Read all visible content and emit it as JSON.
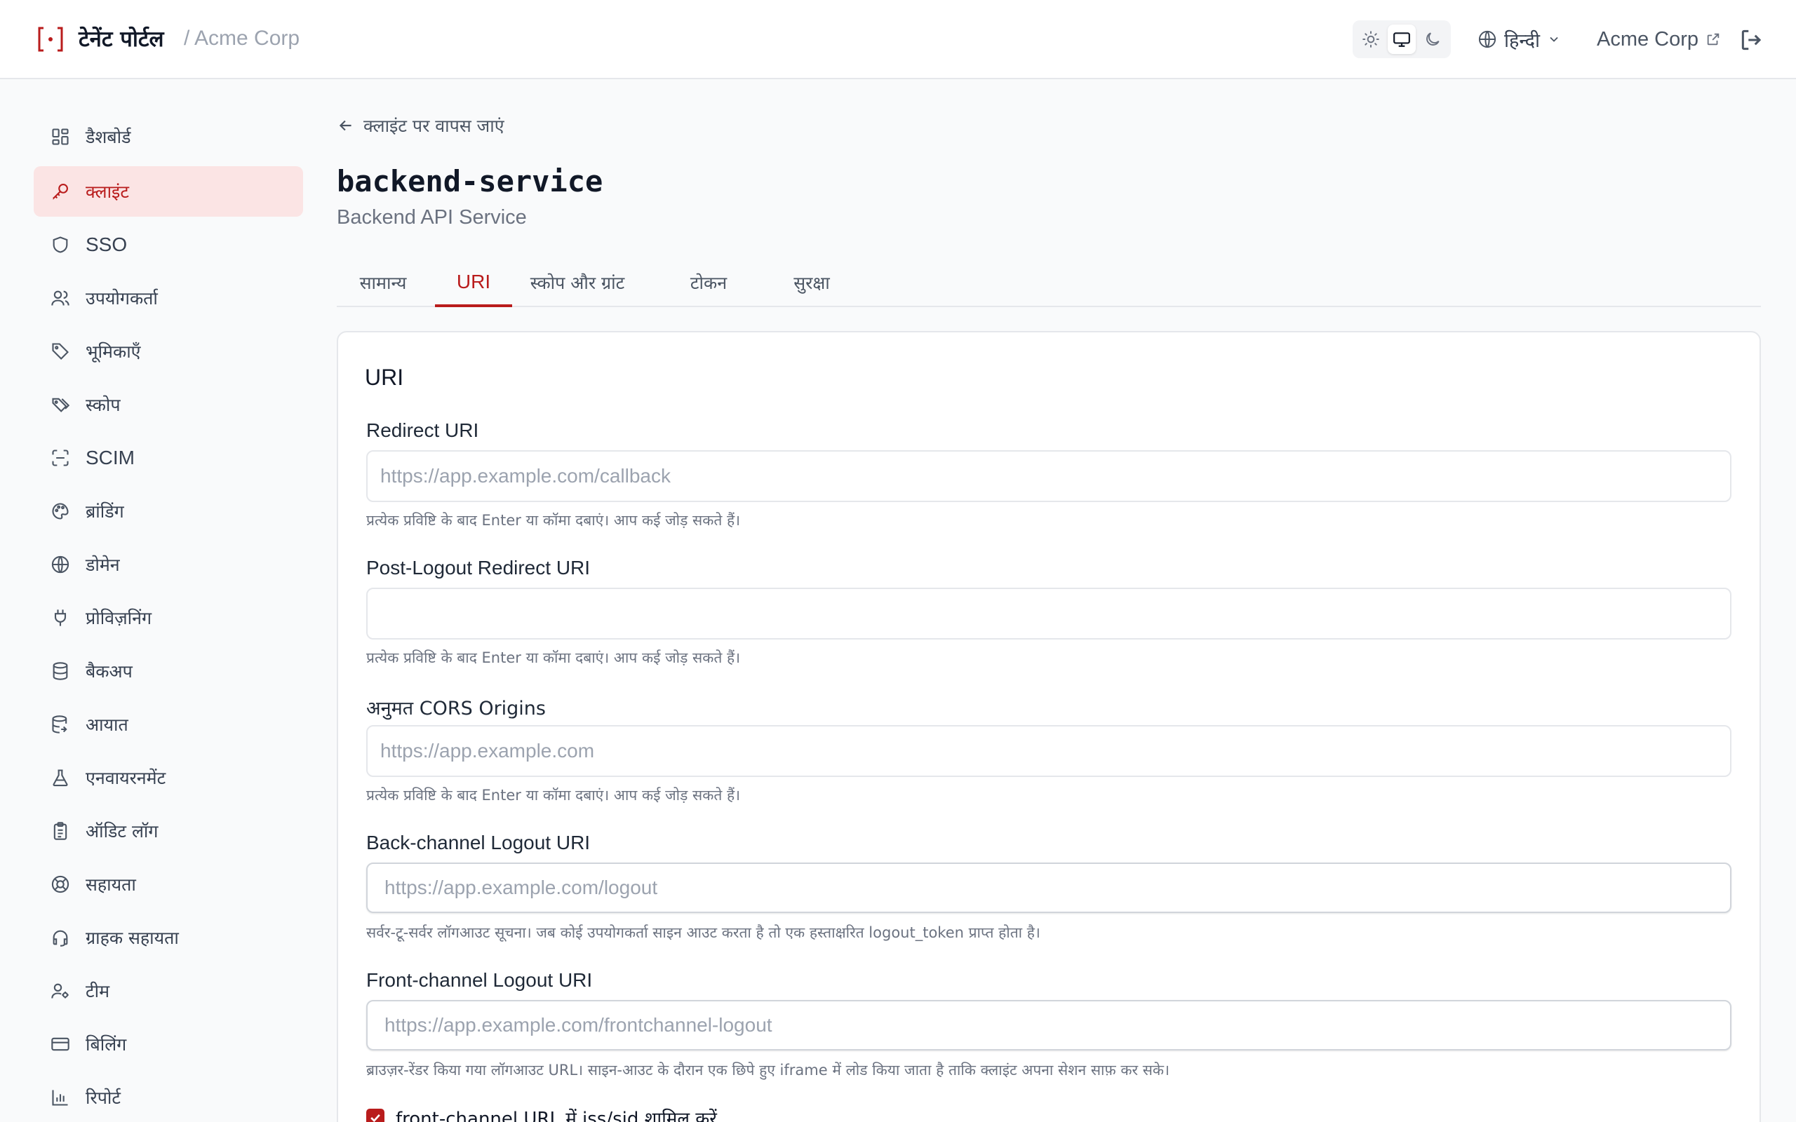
{
  "header": {
    "brand": "टेनेंट पोर्टल",
    "tenant_crumb": "/ Acme Corp",
    "language": "हिन्दी",
    "tenant_name": "Acme Corp"
  },
  "sidebar": {
    "items": [
      {
        "label": "डैशबोर्ड",
        "icon": "dashboard-icon"
      },
      {
        "label": "क्लाइंट",
        "icon": "key-icon"
      },
      {
        "label": "SSO",
        "icon": "shield-icon"
      },
      {
        "label": "उपयोगकर्ता",
        "icon": "users-icon"
      },
      {
        "label": "भूमिकाएँ",
        "icon": "tag-icon"
      },
      {
        "label": "स्कोप",
        "icon": "tags-icon"
      },
      {
        "label": "SCIM",
        "icon": "scan-icon"
      },
      {
        "label": "ब्रांडिंग",
        "icon": "palette-icon"
      },
      {
        "label": "डोमेन",
        "icon": "globe-icon"
      },
      {
        "label": "प्रोविज़निंग",
        "icon": "plug-icon"
      },
      {
        "label": "बैकअप",
        "icon": "database-icon"
      },
      {
        "label": "आयात",
        "icon": "database-import-icon"
      },
      {
        "label": "एनवायरनमेंट",
        "icon": "flask-icon"
      },
      {
        "label": "ऑडिट लॉग",
        "icon": "clipboard-icon"
      },
      {
        "label": "सहायता",
        "icon": "lifebuoy-icon"
      },
      {
        "label": "ग्राहक सहायता",
        "icon": "headset-icon"
      },
      {
        "label": "टीम",
        "icon": "user-cog-icon"
      },
      {
        "label": "बिलिंग",
        "icon": "credit-card-icon"
      },
      {
        "label": "रिपोर्ट",
        "icon": "bar-chart-icon"
      }
    ]
  },
  "main": {
    "back_label": "क्लाइंट पर वापस जाएं",
    "title": "backend-service",
    "subtitle": "Backend API Service",
    "tabs": [
      {
        "label": "सामान्य"
      },
      {
        "label": "URI"
      },
      {
        "label": "स्कोप और ग्रांट"
      },
      {
        "label": "टोकन"
      },
      {
        "label": "सुरक्षा"
      }
    ],
    "active_tab": "URI",
    "card_title": "URI",
    "fields": [
      {
        "label": "Redirect URI",
        "placeholder": "https://app.example.com/callback",
        "value": "",
        "help": "प्रत्येक प्रविष्टि के बाद Enter या कॉमा दबाएं। आप कई जोड़ सकते हैं।"
      },
      {
        "label": "Post-Logout Redirect URI",
        "placeholder": "",
        "value": "",
        "help": "प्रत्येक प्रविष्टि के बाद Enter या कॉमा दबाएं। आप कई जोड़ सकते हैं।"
      },
      {
        "label": "अनुमत CORS Origins",
        "placeholder": "https://app.example.com",
        "value": "",
        "help": "प्रत्येक प्रविष्टि के बाद Enter या कॉमा दबाएं। आप कई जोड़ सकते हैं।"
      },
      {
        "label": "Back-channel Logout URI",
        "placeholder": "https://app.example.com/logout",
        "value": "",
        "help": "सर्वर-टू-सर्वर लॉगआउट सूचना। जब कोई उपयोगकर्ता साइन आउट करता है तो एक हस्ताक्षरित logout_token प्राप्त होता है।"
      },
      {
        "label": "Front-channel Logout URI",
        "placeholder": "https://app.example.com/frontchannel-logout",
        "value": "",
        "help": "ब्राउज़र-रेंडर किया गया लॉगआउट URL। साइन-आउट के दौरान एक छिपे हुए iframe में लोड किया जाता है ताकि क्लाइंट अपना सेशन साफ़ कर सके।"
      }
    ],
    "checkbox": {
      "label": "front-channel URL में iss/sid शामिल करें",
      "checked": true
    }
  },
  "colors": {
    "accent": "#b91c1c",
    "active_bg": "#fbe4e4"
  }
}
